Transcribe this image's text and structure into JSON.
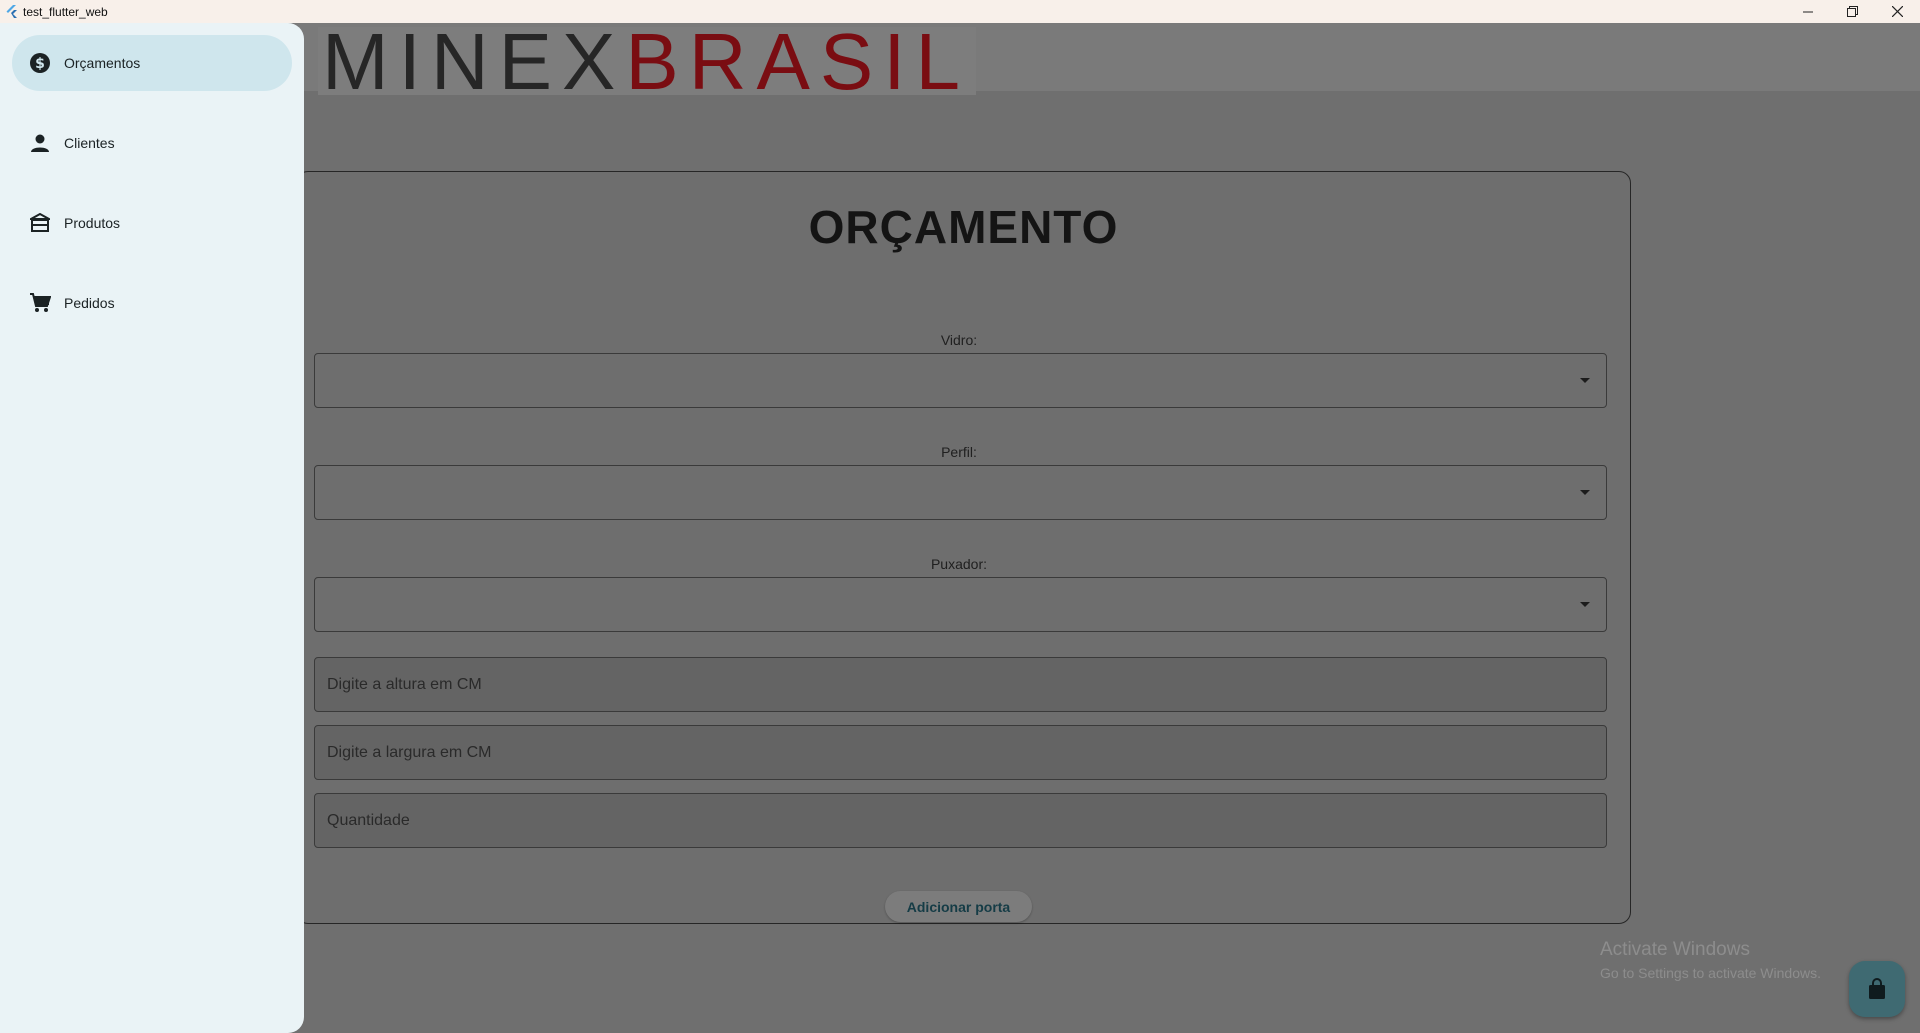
{
  "window": {
    "title": "test_flutter_web"
  },
  "logo": {
    "part1": "MINEX",
    "part2": "BRASIL"
  },
  "sidebar": {
    "items": [
      {
        "label": "Orçamentos",
        "icon": "dollar-circle-icon",
        "active": true
      },
      {
        "label": "Clientes",
        "icon": "person-icon",
        "active": false
      },
      {
        "label": "Produtos",
        "icon": "store-icon",
        "active": false
      },
      {
        "label": "Pedidos",
        "icon": "cart-icon",
        "active": false
      }
    ]
  },
  "form": {
    "title": "ORÇAMENTO",
    "vidro_label": "Vidro:",
    "perfil_label": "Perfil:",
    "puxador_label": "Puxador:",
    "altura_placeholder": "Digite a altura em CM",
    "largura_placeholder": "Digite a largura em CM",
    "quantidade_placeholder": "Quantidade",
    "add_button": "Adicionar porta"
  },
  "watermark": {
    "line1": "Activate Windows",
    "line2": "Go to Settings to activate Windows."
  },
  "fab": {
    "icon": "shopping-bag-icon"
  },
  "colors": {
    "sidebar_bg": "#eaf3f6",
    "active_item": "#cfe6ed",
    "overlay_bg": "#6f6f6f",
    "fab_bg": "#3f6a72"
  }
}
